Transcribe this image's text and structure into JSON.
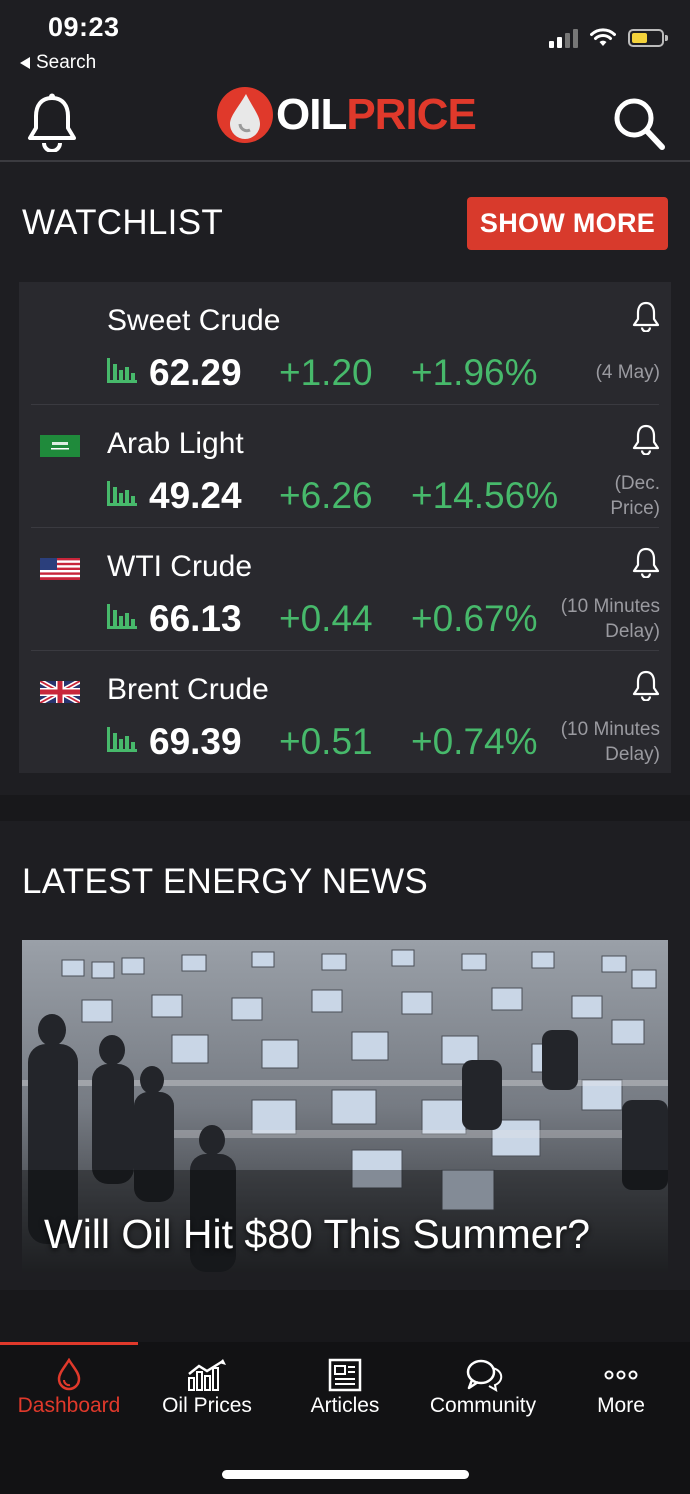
{
  "status_bar": {
    "time": "09:23",
    "back_label": "Search",
    "battery_level": 0.55
  },
  "header": {
    "logo_oil": "OIL",
    "logo_price": "PRICE"
  },
  "watchlist": {
    "title": "WATCHLIST",
    "show_more_label": "SHOW MORE",
    "items": [
      {
        "name": "Sweet Crude",
        "price": "62.29",
        "change": "+1.20",
        "change_pct": "+1.96%",
        "note_line1": "(4 May)",
        "note_line2": "",
        "flag": "none"
      },
      {
        "name": "Arab Light",
        "price": "49.24",
        "change": "+6.26",
        "change_pct": "+14.56%",
        "note_line1": "(Dec.",
        "note_line2": "Price)",
        "flag": "saudi-arabia"
      },
      {
        "name": "WTI Crude",
        "price": "66.13",
        "change": "+0.44",
        "change_pct": "+0.67%",
        "note_line1": "(10 Minutes",
        "note_line2": "Delay)",
        "flag": "usa"
      },
      {
        "name": "Brent Crude",
        "price": "69.39",
        "change": "+0.51",
        "change_pct": "+0.74%",
        "note_line1": "(10 Minutes",
        "note_line2": "Delay)",
        "flag": "uk"
      }
    ]
  },
  "news": {
    "title": "LATEST ENERGY NEWS",
    "headline": "Will Oil Hit $80 This Summer?"
  },
  "tabbar": {
    "items": [
      {
        "label": "Dashboard",
        "icon": "flame-drop-icon",
        "active": true
      },
      {
        "label": "Oil Prices",
        "icon": "bar-chart-trend-icon",
        "active": false
      },
      {
        "label": "Articles",
        "icon": "newspaper-icon",
        "active": false
      },
      {
        "label": "Community",
        "icon": "chat-bubbles-icon",
        "active": false
      },
      {
        "label": "More",
        "icon": "ellipsis-icon",
        "active": false
      }
    ]
  },
  "colors": {
    "accent": "#e0392b",
    "positive": "#47b96b",
    "background": "#1e1e22",
    "card": "#29292e"
  }
}
